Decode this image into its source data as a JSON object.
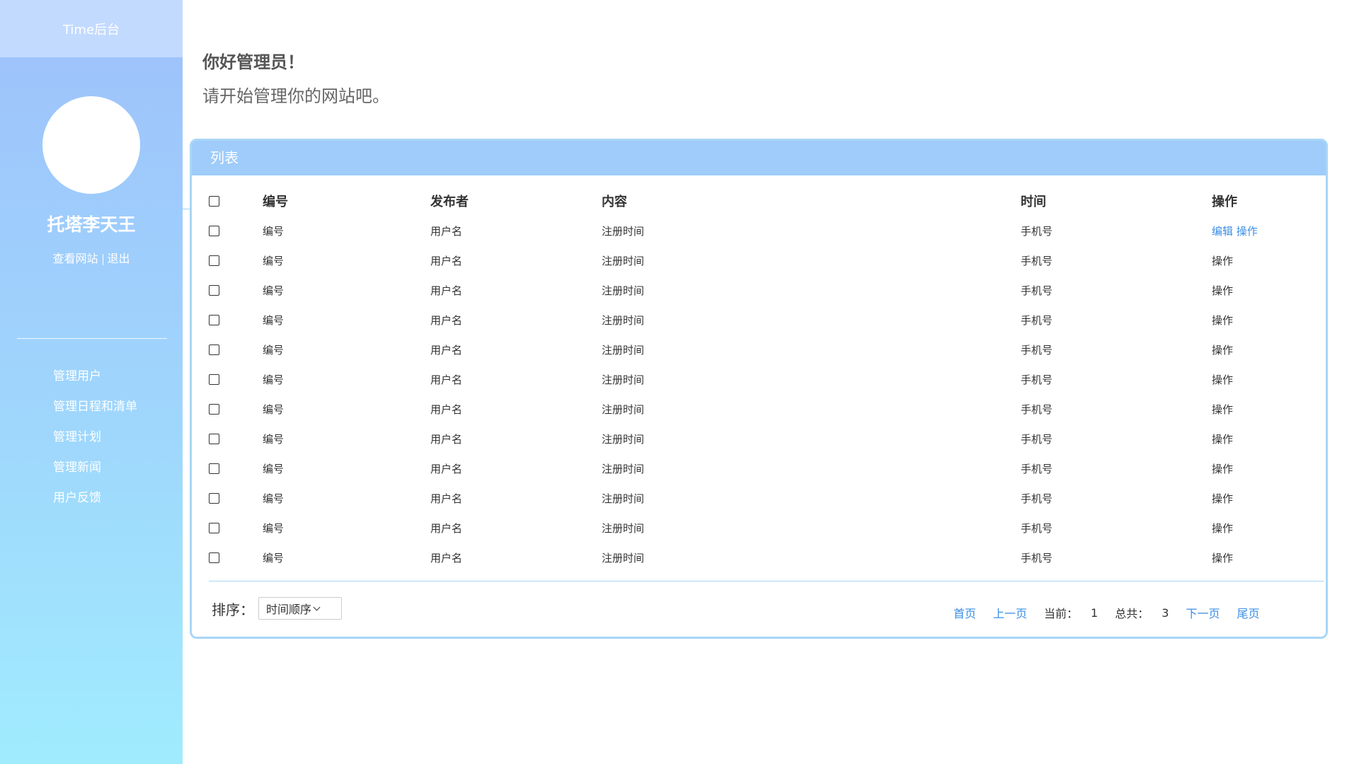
{
  "sidebar": {
    "brand": "Time后台",
    "user_name": "托塔李天王",
    "links": [
      "查看网站",
      "退出"
    ],
    "nav": [
      "管理用户",
      "管理日程和清单",
      "管理计划",
      "管理新闻",
      "用户反馈"
    ]
  },
  "greeting": {
    "title": "你好管理员！",
    "subtitle": "请开始管理你的网站吧。"
  },
  "panel": {
    "title": "列表",
    "columns": [
      "编号",
      "发布者",
      "内容",
      "时间",
      "操作"
    ],
    "rows": [
      {
        "id": "编号",
        "publisher": "用户名",
        "content": "注册时间",
        "time": "手机号",
        "edit": "编辑",
        "action": "操作"
      },
      {
        "id": "编号",
        "publisher": "用户名",
        "content": "注册时间",
        "time": "手机号",
        "action": "操作"
      },
      {
        "id": "编号",
        "publisher": "用户名",
        "content": "注册时间",
        "time": "手机号",
        "action": "操作"
      },
      {
        "id": "编号",
        "publisher": "用户名",
        "content": "注册时间",
        "time": "手机号",
        "action": "操作"
      },
      {
        "id": "编号",
        "publisher": "用户名",
        "content": "注册时间",
        "time": "手机号",
        "action": "操作"
      },
      {
        "id": "编号",
        "publisher": "用户名",
        "content": "注册时间",
        "time": "手机号",
        "action": "操作"
      },
      {
        "id": "编号",
        "publisher": "用户名",
        "content": "注册时间",
        "time": "手机号",
        "action": "操作"
      },
      {
        "id": "编号",
        "publisher": "用户名",
        "content": "注册时间",
        "time": "手机号",
        "action": "操作"
      },
      {
        "id": "编号",
        "publisher": "用户名",
        "content": "注册时间",
        "time": "手机号",
        "action": "操作"
      },
      {
        "id": "编号",
        "publisher": "用户名",
        "content": "注册时间",
        "time": "手机号",
        "action": "操作"
      },
      {
        "id": "编号",
        "publisher": "用户名",
        "content": "注册时间",
        "time": "手机号",
        "action": "操作"
      },
      {
        "id": "编号",
        "publisher": "用户名",
        "content": "注册时间",
        "time": "手机号",
        "action": "操作"
      }
    ],
    "sort_label": "排序：",
    "sort_value": "时间顺序",
    "pager": {
      "first": "首页",
      "prev": "上一页",
      "current_label": "当前：",
      "current": "1",
      "total_label": "总共：",
      "total": "3",
      "next": "下一页",
      "last": "尾页"
    }
  },
  "colors": {
    "sidebar_top": "#9ec1fb",
    "sidebar_bottom": "#a0ecfe",
    "panel_header": "#9fccfa",
    "link": "#3a8ee6"
  }
}
